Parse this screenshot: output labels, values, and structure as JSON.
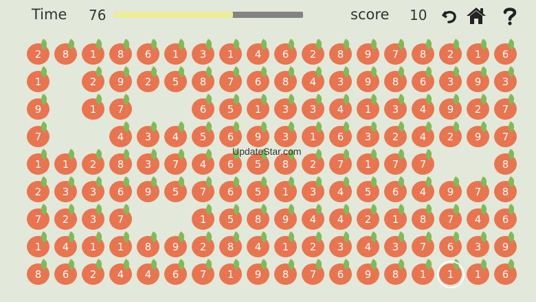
{
  "hud": {
    "time_label": "Time",
    "time_value": "76",
    "time_fraction": 0.63,
    "score_label": "score",
    "score_value": "10",
    "undo_icon": "undo-icon",
    "home_icon": "home-icon",
    "help_icon": "help-icon"
  },
  "watermark": "UpdateStar.com",
  "colors": {
    "fruit": "#e8754f",
    "leaf": "#7fbb57",
    "background": "#e3e9da",
    "timer_fill": "#ecec9a",
    "timer_track": "#838383"
  },
  "selected": {
    "row": 8,
    "col": 15
  },
  "board": [
    [
      "2",
      "8",
      "1",
      "8",
      "6",
      "1",
      "3",
      "1",
      "4",
      "6",
      "2",
      "8",
      "9",
      "7",
      "8",
      "2",
      "1",
      "6"
    ],
    [
      "1",
      "",
      "2",
      "9",
      "2",
      "5",
      "8",
      "7",
      "6",
      "8",
      "4",
      "3",
      "9",
      "8",
      "6",
      "3",
      "9",
      "3"
    ],
    [
      "9",
      "",
      "1",
      "7",
      "",
      "",
      "6",
      "5",
      "1",
      "3",
      "3",
      "4",
      "1",
      "3",
      "4",
      "9",
      "2",
      "7"
    ],
    [
      "7",
      "",
      "",
      "4",
      "3",
      "4",
      "5",
      "6",
      "9",
      "3",
      "1",
      "6",
      "3",
      "2",
      "4",
      "2",
      "9",
      "7"
    ],
    [
      "1",
      "1",
      "2",
      "8",
      "3",
      "7",
      "4",
      "6",
      "5",
      "8",
      "2",
      "7",
      "1",
      "7",
      "7",
      "",
      "",
      "8"
    ],
    [
      "2",
      "3",
      "3",
      "6",
      "9",
      "5",
      "7",
      "6",
      "5",
      "1",
      "3",
      "4",
      "5",
      "6",
      "4",
      "9",
      "7",
      "8"
    ],
    [
      "7",
      "2",
      "3",
      "7",
      "",
      "",
      "1",
      "5",
      "8",
      "9",
      "4",
      "4",
      "2",
      "1",
      "8",
      "7",
      "4",
      "6"
    ],
    [
      "1",
      "4",
      "1",
      "1",
      "8",
      "9",
      "2",
      "8",
      "4",
      "1",
      "2",
      "3",
      "4",
      "3",
      "7",
      "6",
      "3",
      "9"
    ],
    [
      "8",
      "6",
      "2",
      "4",
      "4",
      "6",
      "7",
      "1",
      "9",
      "8",
      "7",
      "6",
      "9",
      "8",
      "1",
      "1",
      "1",
      "6"
    ]
  ]
}
